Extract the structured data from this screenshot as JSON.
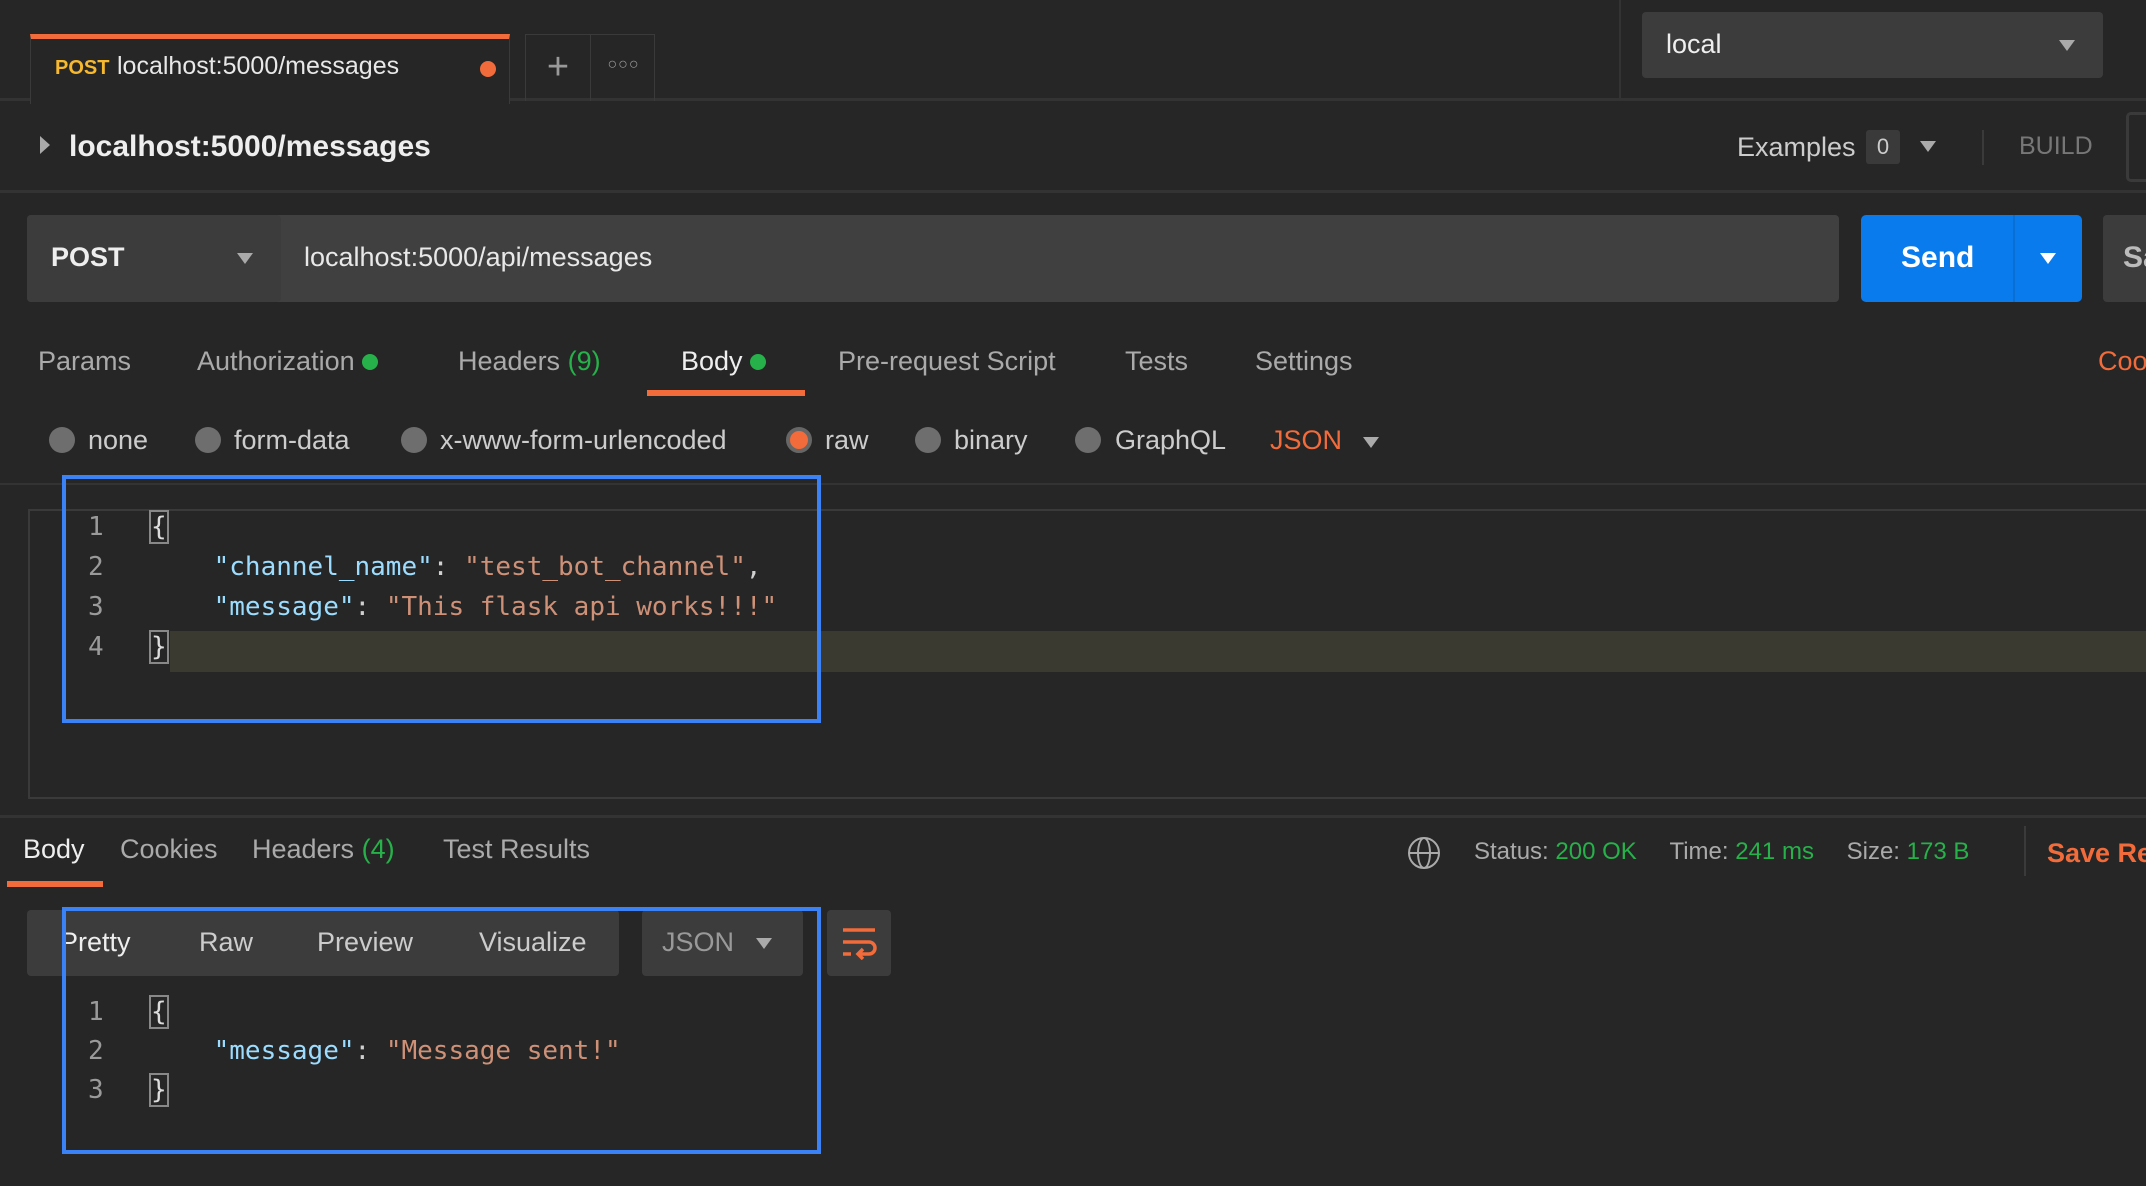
{
  "tab": {
    "method": "POST",
    "title": "localhost:5000/messages",
    "unsaved_color": "#f26b3a"
  },
  "environment": {
    "selected": "local"
  },
  "request": {
    "name": "localhost:5000/messages",
    "examples_label": "Examples",
    "examples_count": "0",
    "build_label": "BUILD",
    "method": "POST",
    "url": "localhost:5000/api/messages",
    "send_label": "Send",
    "save_label": "Sa"
  },
  "req_tabs": [
    {
      "label": "Params"
    },
    {
      "label": "Authorization"
    },
    {
      "label": "Headers",
      "count": "(9)"
    },
    {
      "label": "Body"
    },
    {
      "label": "Pre-request Script"
    },
    {
      "label": "Tests"
    },
    {
      "label": "Settings"
    }
  ],
  "cookies_label": "Coo",
  "body_types": [
    "none",
    "form-data",
    "x-www-form-urlencoded",
    "raw",
    "binary",
    "GraphQL"
  ],
  "body_format": "JSON",
  "request_body": [
    {
      "n": "1",
      "code": [
        {
          "t": "{",
          "c": ""
        }
      ]
    },
    {
      "n": "2",
      "code": [
        {
          "t": "    ",
          "c": ""
        },
        {
          "t": "\"channel_name\"",
          "c": "key"
        },
        {
          "t": ": ",
          "c": ""
        },
        {
          "t": "\"test_bot_channel\"",
          "c": "str"
        },
        {
          "t": ",",
          "c": ""
        }
      ]
    },
    {
      "n": "3",
      "code": [
        {
          "t": "    ",
          "c": ""
        },
        {
          "t": "\"message\"",
          "c": "key"
        },
        {
          "t": ": ",
          "c": ""
        },
        {
          "t": "\"This flask api works!!!\"",
          "c": "str"
        }
      ]
    },
    {
      "n": "4",
      "code": [
        {
          "t": "}",
          "c": ""
        }
      ]
    }
  ],
  "response": {
    "tabs": [
      {
        "label": "Body"
      },
      {
        "label": "Cookies"
      },
      {
        "label": "Headers",
        "count": "(4)"
      },
      {
        "label": "Test Results"
      }
    ],
    "status_label": "Status:",
    "status": "200 OK",
    "time_label": "Time:",
    "time": "241 ms",
    "size_label": "Size:",
    "size": "173 B",
    "save_label": "Save Re",
    "views": [
      "Pretty",
      "Raw",
      "Preview",
      "Visualize"
    ],
    "format": "JSON",
    "body": [
      {
        "n": "1",
        "code": [
          {
            "t": "{",
            "c": ""
          }
        ]
      },
      {
        "n": "2",
        "code": [
          {
            "t": "    ",
            "c": ""
          },
          {
            "t": "\"message\"",
            "c": "key"
          },
          {
            "t": ": ",
            "c": ""
          },
          {
            "t": "\"Message sent!\"",
            "c": "str"
          }
        ]
      },
      {
        "n": "3",
        "code": [
          {
            "t": "}",
            "c": ""
          }
        ]
      }
    ]
  },
  "colors": {
    "accent": "#f26b3a",
    "success": "#26b14a",
    "primary": "#097bed",
    "annotation": "#3b82f6"
  }
}
